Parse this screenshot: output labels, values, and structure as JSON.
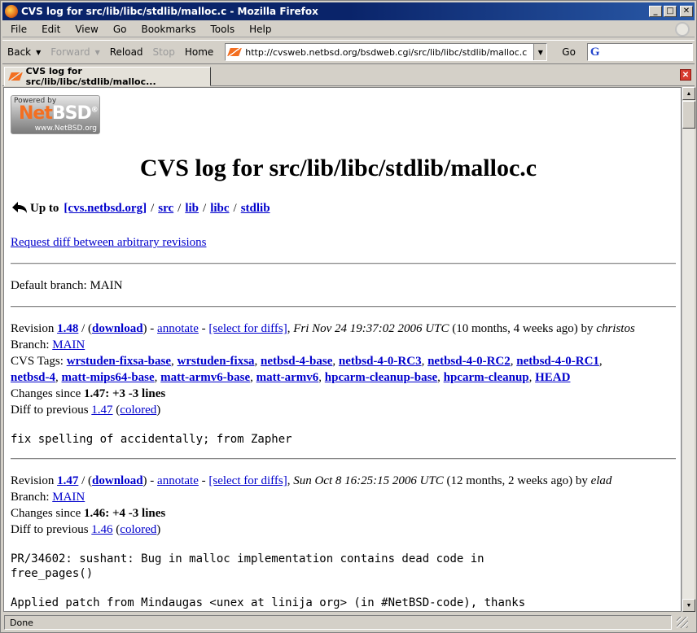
{
  "window": {
    "title": "CVS log for src/lib/libc/stdlib/malloc.c - Mozilla Firefox"
  },
  "menu": [
    "File",
    "Edit",
    "View",
    "Go",
    "Bookmarks",
    "Tools",
    "Help"
  ],
  "nav": {
    "back": "Back",
    "forward": "Forward",
    "reload": "Reload",
    "stop": "Stop",
    "home": "Home",
    "url": "http://cvsweb.netbsd.org/bsdweb.cgi/src/lib/libc/stdlib/malloc.c",
    "go": "Go",
    "search_placeholder": ""
  },
  "tab": {
    "label": "CVS log for src/lib/libc/stdlib/malloc..."
  },
  "logo": {
    "powered": "Powered by",
    "name_a": "Net",
    "name_b": "BSD",
    "reg": "®",
    "site": "www.NetBSD.org"
  },
  "page": {
    "heading": "CVS log for src/lib/libc/stdlib/malloc.c",
    "up_to_label": "Up to",
    "crumbs": [
      "[cvs.netbsd.org]",
      "src",
      "lib",
      "libc",
      "stdlib"
    ],
    "request_diff": "Request diff between arbitrary revisions",
    "default_branch": "Default branch: MAIN"
  },
  "revisions": [
    {
      "revision_label": "Revision",
      "revision": "1.48",
      "download": "download",
      "annotate": "annotate",
      "select": "[select for diffs]",
      "date": "Fri Nov 24 19:37:02 2006 UTC",
      "age": "(10 months, 4 weeks ago) by",
      "author": "christos",
      "branch_label": "Branch:",
      "branch": "MAIN",
      "tags_label": "CVS Tags:",
      "tags_line1": [
        "wrstuden-fixsa-base",
        "wrstuden-fixsa",
        "netbsd-4-base",
        "netbsd-4-0-RC3",
        "netbsd-4-0-RC2",
        "netbsd-4-0-RC1"
      ],
      "tags_line2": [
        "netbsd-4",
        "matt-mips64-base",
        "matt-armv6-base",
        "matt-armv6",
        "hpcarm-cleanup-base",
        "hpcarm-cleanup",
        "HEAD"
      ],
      "changes_label": "Changes since",
      "changes_rev": "1.47:",
      "changes": "+3 -3 lines",
      "diff_label": "Diff to previous",
      "diff_rev": "1.47",
      "colored": "colored",
      "message": "fix spelling of accidentally; from Zapher"
    },
    {
      "revision_label": "Revision",
      "revision": "1.47",
      "download": "download",
      "annotate": "annotate",
      "select": "[select for diffs]",
      "date": "Sun Oct 8 16:25:15 2006 UTC",
      "age": "(12 months, 2 weeks ago) by",
      "author": "elad",
      "branch_label": "Branch:",
      "branch": "MAIN",
      "changes_label": "Changes since",
      "changes_rev": "1.46:",
      "changes": "+4 -3 lines",
      "diff_label": "Diff to previous",
      "diff_rev": "1.46",
      "colored": "colored",
      "message_line1": "PR/34602: sushant: Bug in malloc implementation contains dead code in",
      "message_line2": "free_pages()",
      "message_line3": "Applied patch from Mindaugas <unex at linija org> (in #NetBSD-code), thanks"
    }
  ],
  "status": "Done"
}
